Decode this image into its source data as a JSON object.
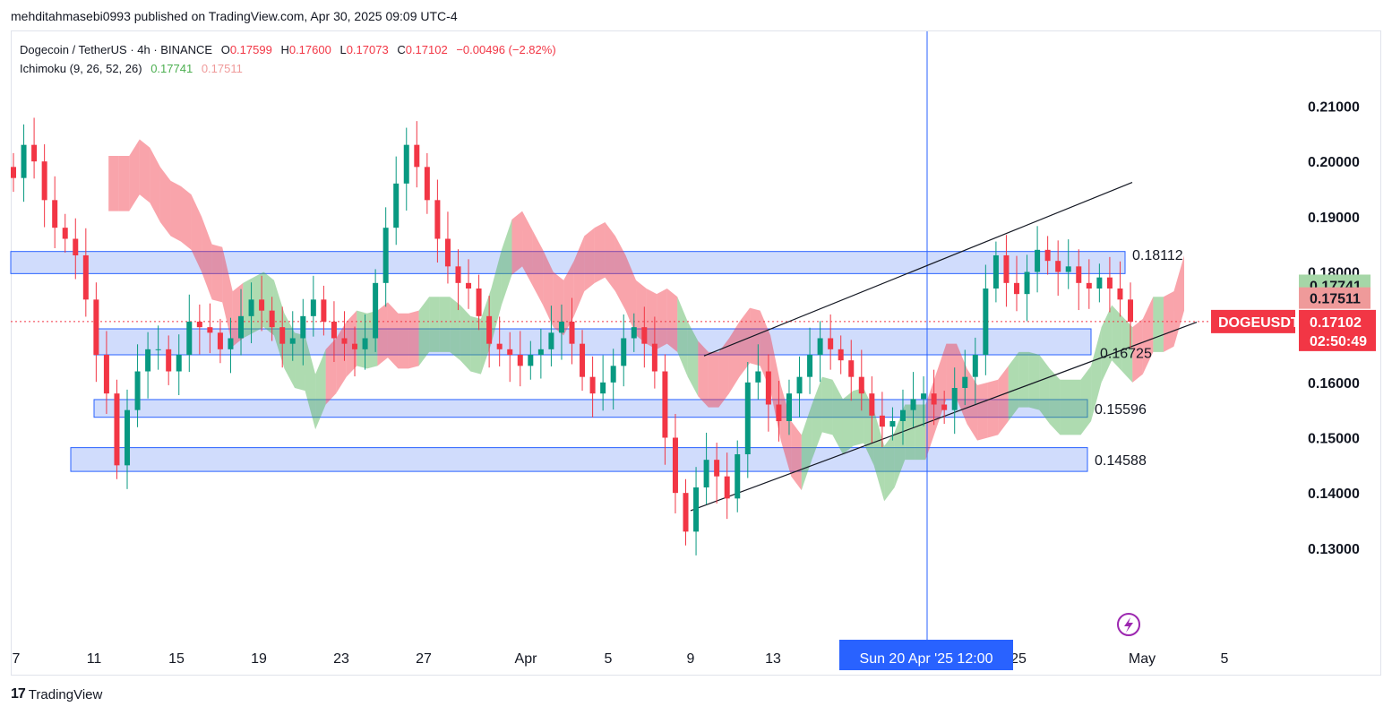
{
  "header": {
    "publisher": "mehditahmasebi0993 published on TradingView.com, Apr 30, 2025 09:09 UTC-4"
  },
  "legend": {
    "symbol": "Dogecoin / TetherUS · 4h · BINANCE",
    "o_label": "O",
    "o": "0.17599",
    "h_label": "H",
    "h": "0.17600",
    "l_label": "L",
    "l": "0.17073",
    "c_label": "C",
    "c": "0.17102",
    "change": "−0.00496 (−2.82%)",
    "indicator": "Ichimoku (9, 26, 52, 26)",
    "ind_v1": "0.17741",
    "ind_v2": "0.17511"
  },
  "footer": {
    "brand": "TradingView",
    "brand_mark": "17"
  },
  "colors": {
    "up": "#089981",
    "down": "#f23645",
    "cloud_bull": "#4caf50",
    "cloud_bear": "#f23645",
    "zone_fill": "#c8d6fb",
    "zone_border": "#2962ff",
    "crosshair": "#2962ff",
    "bg": "#ffffff"
  },
  "chart_data": {
    "type": "candlestick",
    "symbol": "DOGEUSDT",
    "timeframe": "4h",
    "ylim": [
      0.123,
      0.213
    ],
    "y_ticks": [
      "0.21000",
      "0.20000",
      "0.19000",
      "0.18000",
      "0.17000",
      "0.16000",
      "0.15000",
      "0.14000",
      "0.13000"
    ],
    "x_ticks": [
      "7",
      "11",
      "15",
      "19",
      "23",
      "27",
      "Apr",
      "5",
      "9",
      "13",
      "25",
      "May",
      "5"
    ],
    "crosshair_label": "Sun 20 Apr '25   12:00",
    "price_badges": [
      {
        "label": "",
        "value": "0.17741",
        "color": "#a5d6a7"
      },
      {
        "label": "",
        "value": "0.17511",
        "color": "#ef9a9a"
      },
      {
        "label": "DOGEUSDT",
        "value": "0.17102",
        "timer": "02:50:49",
        "color": "#f23645"
      }
    ],
    "zones": [
      {
        "label": "0.18112",
        "top": 0.1837,
        "bottom": 0.1797
      },
      {
        "label": "0.16725",
        "top": 0.1697,
        "bottom": 0.165
      },
      {
        "label": "0.15596",
        "top": 0.1569,
        "bottom": 0.1537
      },
      {
        "label": "0.14588",
        "top": 0.1482,
        "bottom": 0.1439
      }
    ],
    "channel": {
      "upper": {
        "from_label": "9",
        "from": 0.1648,
        "to_label": "May",
        "to": 0.1962
      },
      "lower": {
        "from_label": "9",
        "from": 0.1368,
        "to_label": "May",
        "to": 0.1709
      }
    },
    "last_price": 0.17102,
    "price_path": [
      0.197,
      0.203,
      0.2,
      0.193,
      0.188,
      0.186,
      0.183,
      0.175,
      0.165,
      0.158,
      0.145,
      0.155,
      0.162,
      0.166,
      0.166,
      0.162,
      0.165,
      0.171,
      0.17,
      0.169,
      0.166,
      0.168,
      0.172,
      0.175,
      0.173,
      0.17,
      0.167,
      0.168,
      0.172,
      0.175,
      0.171,
      0.168,
      0.167,
      0.166,
      0.168,
      0.178,
      0.188,
      0.196,
      0.203,
      0.199,
      0.193,
      0.186,
      0.181,
      0.178,
      0.177,
      0.172,
      0.167,
      0.166,
      0.165,
      0.163,
      0.165,
      0.166,
      0.169,
      0.171,
      0.167,
      0.161,
      0.158,
      0.16,
      0.163,
      0.168,
      0.17,
      0.167,
      0.162,
      0.15,
      0.14,
      0.133,
      0.141,
      0.146,
      0.143,
      0.139,
      0.147,
      0.16,
      0.162,
      0.156,
      0.153,
      0.158,
      0.161,
      0.165,
      0.168,
      0.166,
      0.164,
      0.161,
      0.158,
      0.154,
      0.152,
      0.153,
      0.155,
      0.157,
      0.158,
      0.156,
      0.155,
      0.159,
      0.161,
      0.165,
      0.177,
      0.183,
      0.178,
      0.176,
      0.18,
      0.184,
      0.182,
      0.18,
      0.181,
      0.178,
      0.177,
      0.179,
      0.177,
      0.175,
      0.171
    ]
  }
}
